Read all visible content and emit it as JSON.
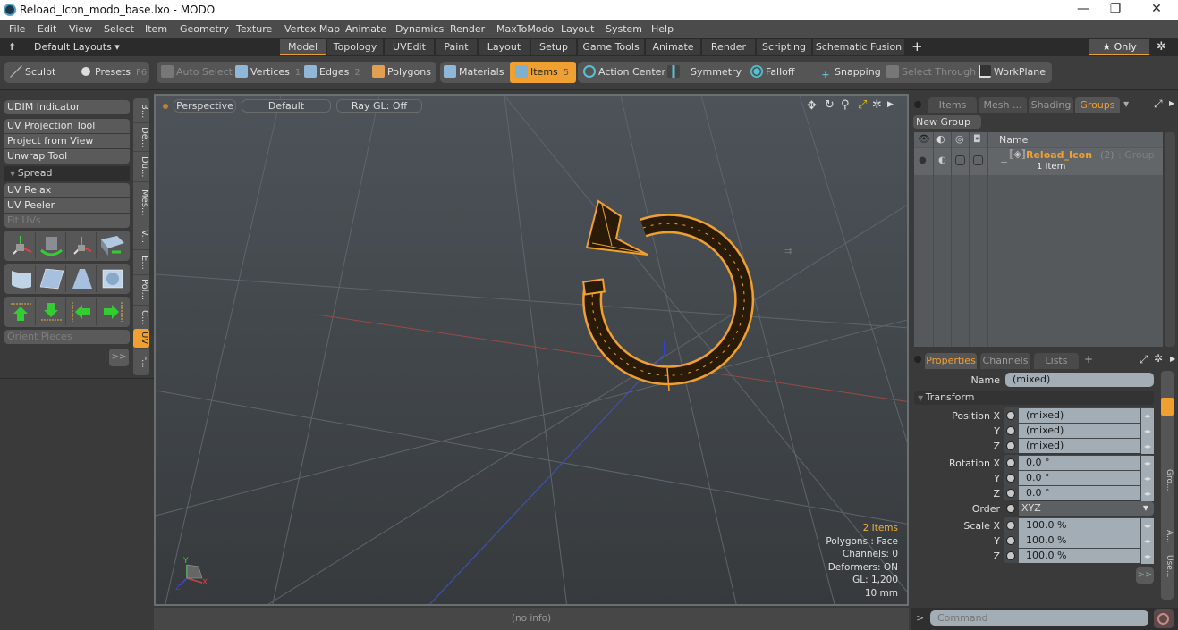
{
  "window": {
    "title": "Reload_Icon_modo_base.lxo - MODO",
    "controls": [
      "minimize",
      "restore",
      "close"
    ]
  },
  "menu": [
    "File",
    "Edit",
    "View",
    "Select",
    "Item",
    "Geometry",
    "Texture",
    "Vertex Map",
    "Animate",
    "Dynamics",
    "Render",
    "MaxToModo",
    "Layout",
    "System",
    "Help"
  ],
  "layoutbar": {
    "default_layouts": "Default Layouts ▾",
    "tabs": [
      "Model",
      "Topology",
      "UVEdit",
      "Paint",
      "Layout",
      "Setup",
      "Game Tools",
      "Animate",
      "Render",
      "Scripting",
      "Schematic Fusion"
    ],
    "active_tab": "Model",
    "add": "+",
    "only_label": "★ Only"
  },
  "toolbar": {
    "sculpt": "Sculpt",
    "presets": "Presets",
    "presets_key": "F6",
    "auto_select": "Auto Select",
    "vertices": "Vertices",
    "vertices_key": "1",
    "edges": "Edges",
    "edges_key": "2",
    "polygons": "Polygons",
    "materials": "Materials",
    "items": "Items",
    "items_key": "5",
    "action_center": "Action Center",
    "symmetry": "Symmetry",
    "falloff": "Falloff",
    "snapping": "Snapping",
    "select_through": "Select Through",
    "workplane": "WorkPlane"
  },
  "leftpanel": {
    "udim": "UDIM Indicator",
    "uv_projection": "UV Projection Tool",
    "project_from_view": "Project from View",
    "unwrap": "Unwrap Tool",
    "spread": "Spread",
    "uv_relax": "UV Relax",
    "uv_peeler": "UV Peeler",
    "fit_uvs": "Fit UVs",
    "orient_pieces": "Orient Pieces",
    "more": ">>",
    "vtabs": [
      "B...",
      "De...",
      "Du...",
      "Mes...",
      "V...",
      "E...",
      "Pol...",
      "C...",
      "UV",
      "F..."
    ],
    "active_vtab": "UV"
  },
  "viewport": {
    "view": "Perspective",
    "shading": "Default",
    "raygl": "Ray GL: Off",
    "info": {
      "items": "2 Items",
      "polygons": "Polygons : Face",
      "channels": "Channels: 0",
      "deformers": "Deformers: ON",
      "gl": "GL: 1,200",
      "scale": "10 mm"
    }
  },
  "status": "(no info)",
  "rightpanel": {
    "tabs": [
      "Items",
      "Mesh ...",
      "Shading",
      "Groups"
    ],
    "active_tab": "Groups",
    "new_group": "New Group",
    "col_name": "Name",
    "group": {
      "name": "Reload_Icon",
      "count": "(2)",
      "type": ": Group",
      "sub": "1 Item"
    }
  },
  "properties": {
    "tabs": [
      "Properties",
      "Channels",
      "Lists",
      "+"
    ],
    "active_tab": "Properties",
    "name_label": "Name",
    "name_value": "(mixed)",
    "transform": "Transform",
    "position": {
      "label_x": "Position X",
      "label_y": "Y",
      "label_z": "Z",
      "x": "(mixed)",
      "y": "(mixed)",
      "z": "(mixed)"
    },
    "rotation": {
      "label_x": "Rotation X",
      "label_y": "Y",
      "label_z": "Z",
      "x": "0.0 °",
      "y": "0.0 °",
      "z": "0.0 °"
    },
    "order_label": "Order",
    "order_value": "XYZ",
    "scale": {
      "label_x": "Scale X",
      "label_y": "Y",
      "label_z": "Z",
      "x": "100.0 %",
      "y": "100.0 %",
      "z": "100.0 %"
    },
    "more": ">>",
    "side_tabs": [
      "...",
      "...",
      "...",
      "...",
      "...",
      "Gro...",
      "...",
      "A...",
      "Use...",
      "..."
    ]
  },
  "command": {
    "prompt": ">",
    "placeholder": "Command"
  },
  "colors": {
    "accent": "#f0a030",
    "selection": "#f0a030",
    "viewport_bg": "#4a4f55"
  }
}
